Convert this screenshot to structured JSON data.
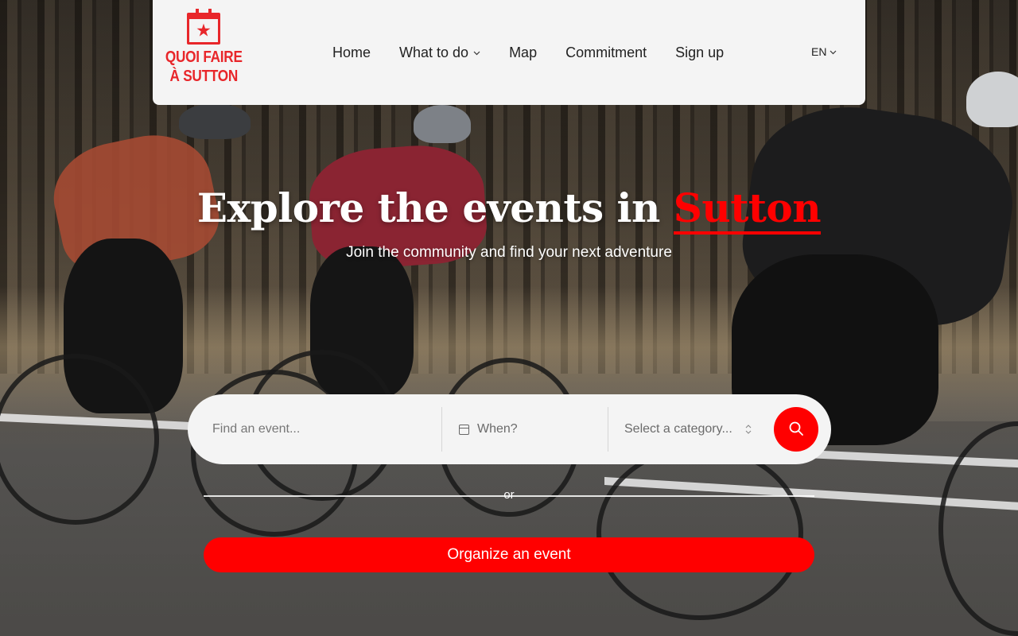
{
  "brand": {
    "logo_line1": "QUOI FAIRE",
    "logo_line2": "À SUTTON",
    "logo_icon": "calendar-star-icon",
    "accent_color": "#ff0000"
  },
  "nav": {
    "items": [
      {
        "label": "Home"
      },
      {
        "label": "What to do",
        "has_dropdown": true
      },
      {
        "label": "Map"
      },
      {
        "label": "Commitment"
      },
      {
        "label": "Sign up"
      }
    ],
    "language": "EN"
  },
  "hero": {
    "title_prefix": "Explore the events in ",
    "title_highlight": "Sutton",
    "subtitle": "Join the community and find your next adventure"
  },
  "search": {
    "event_placeholder": "Find an event...",
    "when_label": "When?",
    "category_label": "Select a category...",
    "submit_icon": "search-icon"
  },
  "divider": {
    "or_label": "or"
  },
  "cta": {
    "organize_label": "Organize an event"
  }
}
